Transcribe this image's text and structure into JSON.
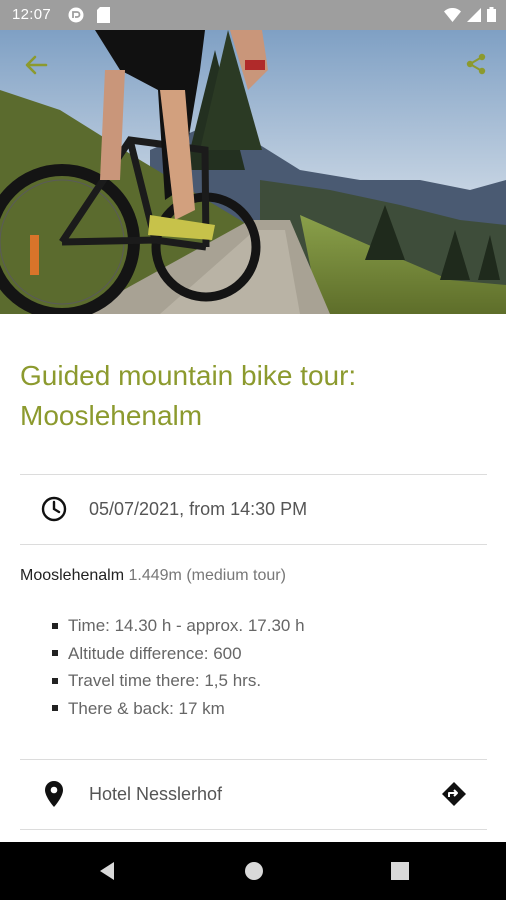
{
  "status_bar": {
    "time": "12:07",
    "icons": [
      "app-notification-icon",
      "sd-card-icon",
      "wifi-icon",
      "signal-icon",
      "battery-icon"
    ]
  },
  "header": {
    "back_icon": "arrow-left-icon",
    "share_icon": "share-icon",
    "accent_color": "#8c9a2e"
  },
  "event": {
    "title": "Guided mountain bike tour: Mooslehenalm",
    "datetime": "05/07/2021, from 14:30 PM",
    "summary_name": "Mooslehenalm",
    "summary_detail": " 1.449m (medium tour)",
    "details": [
      "Time: 14.30 h - approx. 17.30 h",
      "Altitude difference: 600",
      "Travel time there: 1,5 hrs.",
      "There & back: 17 km"
    ],
    "location": "Hotel Nesslerhof"
  },
  "nav_bar": {
    "icons": [
      "back-triangle-icon",
      "home-circle-icon",
      "recents-square-icon"
    ]
  }
}
